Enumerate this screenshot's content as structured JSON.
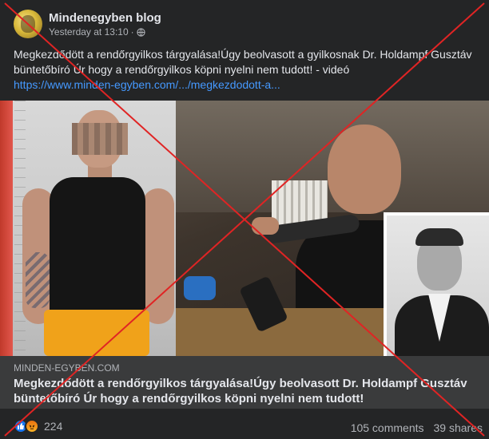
{
  "post": {
    "page_name": "Mindenegyben blog",
    "timestamp": "Yesterday at 13:10",
    "separator": "·",
    "privacy_icon": "globe-icon",
    "text": "Megkezdődött a rendőrgyilkos tárgyalása!Úgy beolvasott a gyilkosnak  Dr. Holdampf Gusztáv büntetőbíró Úr hogy a rendőrgyilkos köpni nyelni nem tudott!  - videó",
    "link_text": "https://www.minden-egyben.com/.../megkezdodott-a..."
  },
  "link_preview": {
    "domain": "MINDEN-EGYBEN.COM",
    "title": "Megkezdődött a rendőrgyilkos tárgyalása!Úgy beolvasott Dr. Holdampf Gusztáv büntetőbíró Úr hogy a rendőrgyilkos köpni nyelni nem tudott!"
  },
  "footer": {
    "reaction_icons": [
      "like-icon",
      "angry-icon"
    ],
    "reaction_count": "224",
    "comments": "105 comments",
    "shares": "39 shares"
  },
  "colors": {
    "background": "#242526",
    "link": "#4599ff",
    "cross": "#e02424",
    "like": "#1877f2"
  }
}
